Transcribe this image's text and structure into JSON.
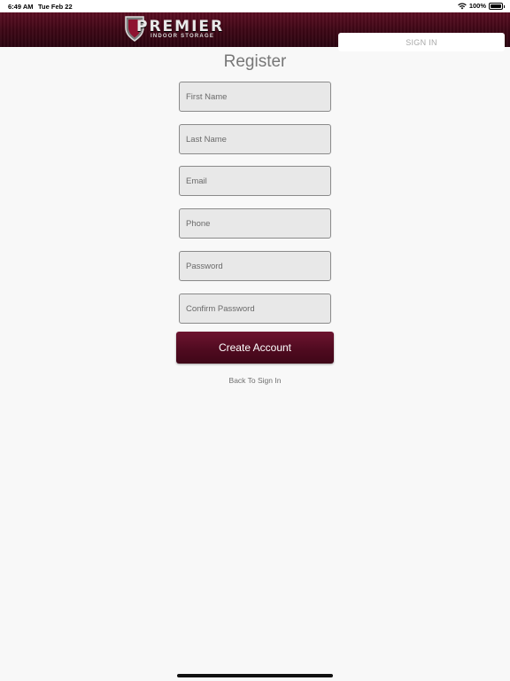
{
  "status_bar": {
    "time": "6:49 AM",
    "date": "Tue Feb 22",
    "battery_percent": "100%",
    "battery_level": 1.0,
    "icons": [
      "wifi-icon",
      "battery-icon"
    ]
  },
  "header": {
    "logo": {
      "brand": "PREMIER",
      "subtitle": "INDOOR STORAGE"
    },
    "signin_label": "SIGN IN",
    "colors": {
      "header_bg": "#3e0716",
      "accent": "#5c0d22"
    }
  },
  "form": {
    "title": "Register",
    "fields": {
      "first_name": {
        "value": "",
        "placeholder": "First Name"
      },
      "last_name": {
        "value": "",
        "placeholder": "Last Name"
      },
      "email": {
        "value": "",
        "placeholder": "Email"
      },
      "phone": {
        "value": "",
        "placeholder": "Phone"
      },
      "password": {
        "value": "",
        "placeholder": "Password"
      },
      "confirm_password": {
        "value": "",
        "placeholder": "Confirm Password"
      }
    },
    "create_label": "Create Account",
    "back_label": "Back To Sign In"
  }
}
